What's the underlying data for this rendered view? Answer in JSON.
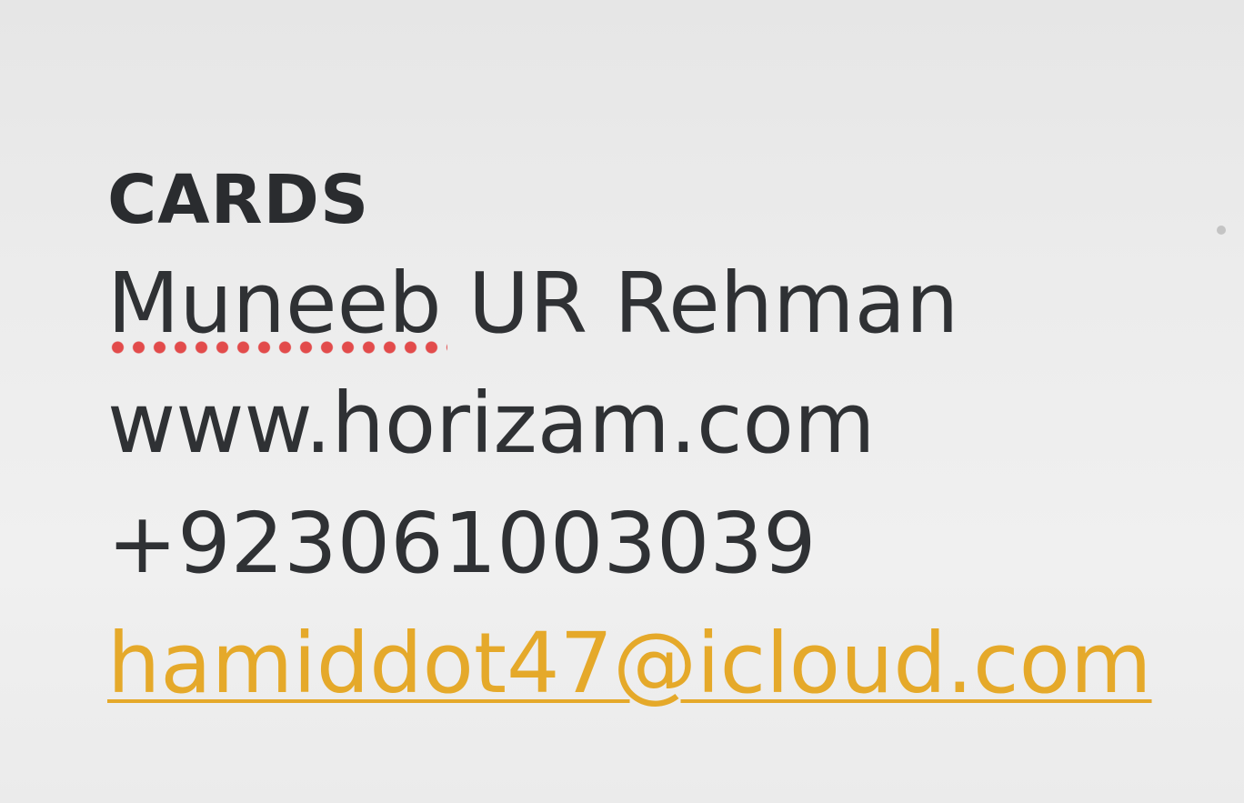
{
  "card": {
    "section_title": "CARDS",
    "name_first": "Muneeb",
    "name_rest": " UR Rehman",
    "website": "www.horizam.com",
    "phone": "+923061003039",
    "email": "hamiddot47@icloud.com"
  },
  "colors": {
    "email_link": "#e5a92a",
    "spellcheck_underline": "#e24b4b",
    "text": "#2f3134"
  }
}
